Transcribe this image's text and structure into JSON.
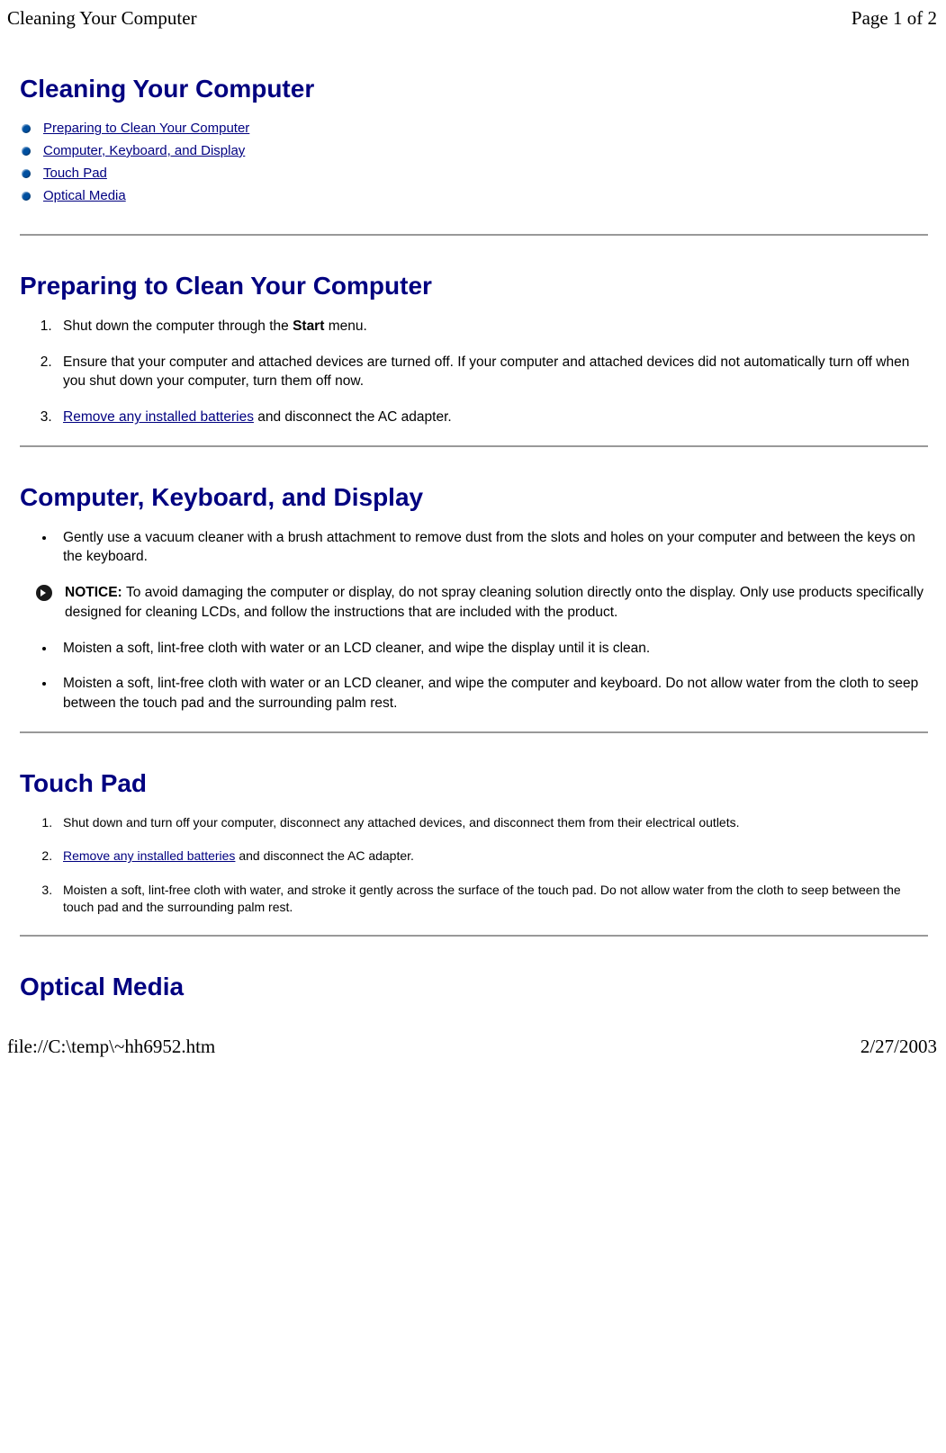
{
  "header": {
    "title": "Cleaning Your Computer",
    "pageInfo": "Page 1 of 2"
  },
  "footer": {
    "filePath": "file://C:\\temp\\~hh6952.htm",
    "date": "2/27/2003"
  },
  "mainTitle": "Cleaning Your Computer",
  "navLinks": [
    "Preparing to Clean Your Computer",
    "Computer, Keyboard, and Display",
    "Touch Pad",
    "Optical Media"
  ],
  "section1": {
    "heading": "Preparing to Clean Your Computer",
    "item1_pre": "Shut down the computer through the ",
    "item1_bold": "Start",
    "item1_post": " menu.",
    "item2": "Ensure that your computer and attached devices are turned off. If your computer and attached devices did not automatically turn off when you shut down your computer, turn them off now.",
    "item3_link": "Remove any installed batteries",
    "item3_post": " and disconnect the AC adapter."
  },
  "section2": {
    "heading": "Computer, Keyboard, and Display",
    "bullet1": "Gently use a vacuum cleaner with a brush attachment to remove dust from the slots and holes on your computer and between the keys on the keyboard.",
    "notice_label": "NOTICE: ",
    "notice_text": "To avoid damaging the computer or display, do not spray cleaning solution directly onto the display. Only use products specifically designed for cleaning LCDs, and follow the instructions that are included with the product.",
    "bullet2": "Moisten a soft, lint-free cloth with water or an LCD cleaner, and wipe the display until it is clean.",
    "bullet3": "Moisten a soft, lint-free cloth with water or an LCD cleaner, and wipe the computer and keyboard. Do not allow water from the cloth to seep between the touch pad and the surrounding palm rest."
  },
  "section3": {
    "heading": "Touch Pad",
    "item1": "Shut down and turn off your computer, disconnect any attached devices, and disconnect them from their electrical outlets.",
    "item2_link": "Remove any installed batteries",
    "item2_post": " and disconnect the AC adapter.",
    "item3": "Moisten a soft, lint-free cloth with water, and stroke it gently across the surface of the touch pad. Do not allow water from the cloth to seep between the touch pad and the surrounding palm rest."
  },
  "section4": {
    "heading": "Optical Media"
  }
}
